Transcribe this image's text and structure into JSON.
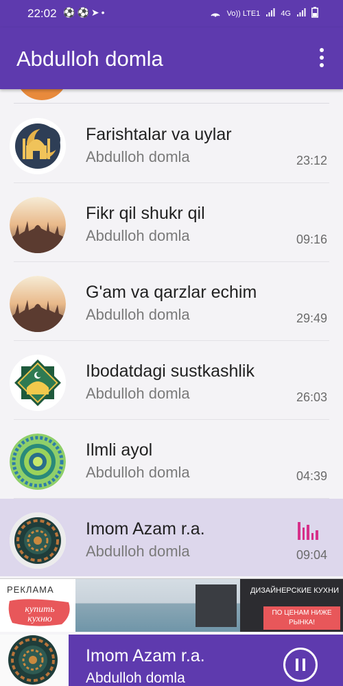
{
  "status_bar": {
    "time": "22:02",
    "left_icons": [
      "soccer-ball-icon",
      "soccer-ball-icon",
      "telegram-icon",
      "dot-icon"
    ],
    "right_icons": [
      "hotspot-icon",
      "volte-icon",
      "signal-icon",
      "4g-icon",
      "signal-icon",
      "battery-icon"
    ],
    "volte_text": "Vo)) LTE1",
    "network_text": "4G"
  },
  "header": {
    "title": "Abdulloh domla",
    "menu_icon": "more-vert-icon"
  },
  "tracks": [
    {
      "title": "Farishtalar va uylar",
      "artist": "Abdulloh domla",
      "duration": "23:12",
      "artwork": "mosque-moon-icon",
      "playing": false
    },
    {
      "title": "Fikr qil shukr qil",
      "artist": "Abdulloh domla",
      "duration": "09:16",
      "artwork": "sunset-city-icon",
      "playing": false
    },
    {
      "title": "G'am va qarzlar echim",
      "artist": "Abdulloh domla",
      "duration": "29:49",
      "artwork": "sunset-city-icon",
      "playing": false
    },
    {
      "title": "Ibodatdagi sustkashlik",
      "artist": "Abdulloh domla",
      "duration": "26:03",
      "artwork": "star-mosque-icon",
      "playing": false
    },
    {
      "title": "Ilmli ayol",
      "artist": "Abdulloh domla",
      "duration": "04:39",
      "artwork": "green-mandala-icon",
      "playing": false
    },
    {
      "title": "Imom Azam r.a.",
      "artist": "Abdulloh domla",
      "duration": "09:04",
      "artwork": "dark-mandala-icon",
      "playing": true
    }
  ],
  "ad": {
    "label": "РЕКЛАМА",
    "logo_text": "купить кухню",
    "headline": "ДИЗАЙНЕРСКИЕ КУХНИ",
    "subline": "ПО ЦЕНАМ НИЖЕ РЫНКА!"
  },
  "now_playing": {
    "title": "Imom Azam r.a.",
    "artist": "Abdulloh domla",
    "artwork": "dark-mandala-icon",
    "control_icon": "pause-icon"
  },
  "colors": {
    "primary": "#5e3aae",
    "active_row": "#ddd7ec",
    "equalizer": "#d6308a"
  }
}
